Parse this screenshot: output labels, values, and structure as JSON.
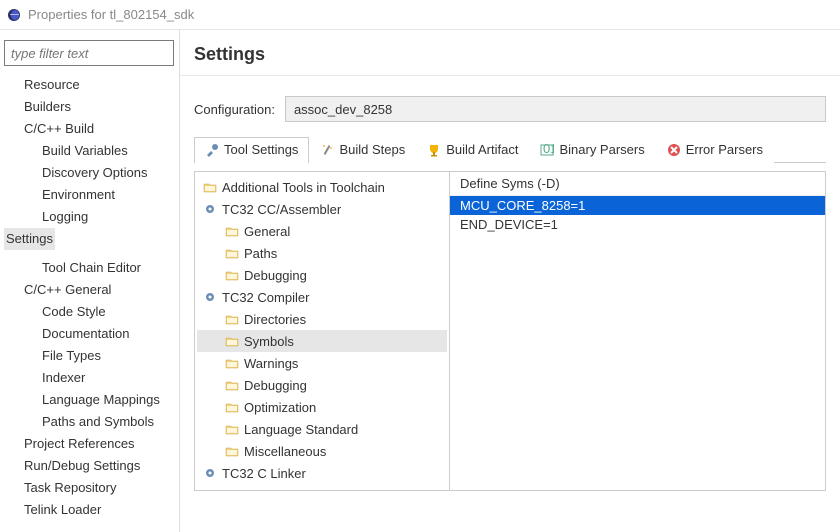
{
  "window": {
    "title": "Properties for tl_802154_sdk"
  },
  "filter": {
    "placeholder": "type filter text"
  },
  "sidebar": {
    "items": [
      {
        "label": "Resource",
        "depth": 0
      },
      {
        "label": "Builders",
        "depth": 0
      },
      {
        "label": "C/C++ Build",
        "depth": 0
      },
      {
        "label": "Build Variables",
        "depth": 1
      },
      {
        "label": "Discovery Options",
        "depth": 1
      },
      {
        "label": "Environment",
        "depth": 1
      },
      {
        "label": "Logging",
        "depth": 1
      },
      {
        "label": "Settings",
        "depth": 1,
        "selected": true
      },
      {
        "label": "Tool Chain Editor",
        "depth": 1
      },
      {
        "label": "C/C++ General",
        "depth": 0
      },
      {
        "label": "Code Style",
        "depth": 1
      },
      {
        "label": "Documentation",
        "depth": 1
      },
      {
        "label": "File Types",
        "depth": 1
      },
      {
        "label": "Indexer",
        "depth": 1
      },
      {
        "label": "Language Mappings",
        "depth": 1
      },
      {
        "label": "Paths and Symbols",
        "depth": 1
      },
      {
        "label": "Project References",
        "depth": 0
      },
      {
        "label": "Run/Debug Settings",
        "depth": 0
      },
      {
        "label": "Task Repository",
        "depth": 0
      },
      {
        "label": "Telink Loader",
        "depth": 0
      }
    ]
  },
  "heading": "Settings",
  "config": {
    "label": "Configuration:",
    "value": "assoc_dev_8258"
  },
  "tabs": [
    {
      "label": "Tool Settings",
      "icon": "tools",
      "active": true
    },
    {
      "label": "Build Steps",
      "icon": "wand"
    },
    {
      "label": "Build Artifact",
      "icon": "trophy"
    },
    {
      "label": "Binary Parsers",
      "icon": "binary"
    },
    {
      "label": "Error Parsers",
      "icon": "error"
    }
  ],
  "tooltree": [
    {
      "label": "Additional Tools in Toolchain",
      "icon": "folder",
      "depth": 0
    },
    {
      "label": "TC32 CC/Assembler",
      "icon": "gear",
      "depth": 0
    },
    {
      "label": "General",
      "icon": "folder",
      "depth": 1
    },
    {
      "label": "Paths",
      "icon": "folder",
      "depth": 1
    },
    {
      "label": "Debugging",
      "icon": "folder",
      "depth": 1
    },
    {
      "label": "TC32 Compiler",
      "icon": "gear",
      "depth": 0
    },
    {
      "label": "Directories",
      "icon": "folder",
      "depth": 1
    },
    {
      "label": "Symbols",
      "icon": "folder",
      "depth": 1,
      "selected": true
    },
    {
      "label": "Warnings",
      "icon": "folder",
      "depth": 1
    },
    {
      "label": "Debugging",
      "icon": "folder",
      "depth": 1
    },
    {
      "label": "Optimization",
      "icon": "folder",
      "depth": 1
    },
    {
      "label": "Language Standard",
      "icon": "folder",
      "depth": 1
    },
    {
      "label": "Miscellaneous",
      "icon": "folder",
      "depth": 1
    },
    {
      "label": "TC32 C Linker",
      "icon": "gear",
      "depth": 0
    }
  ],
  "defs": {
    "header": "Define Syms (-D)",
    "items": [
      {
        "value": "MCU_CORE_8258=1",
        "selected": true
      },
      {
        "value": "END_DEVICE=1"
      }
    ]
  }
}
